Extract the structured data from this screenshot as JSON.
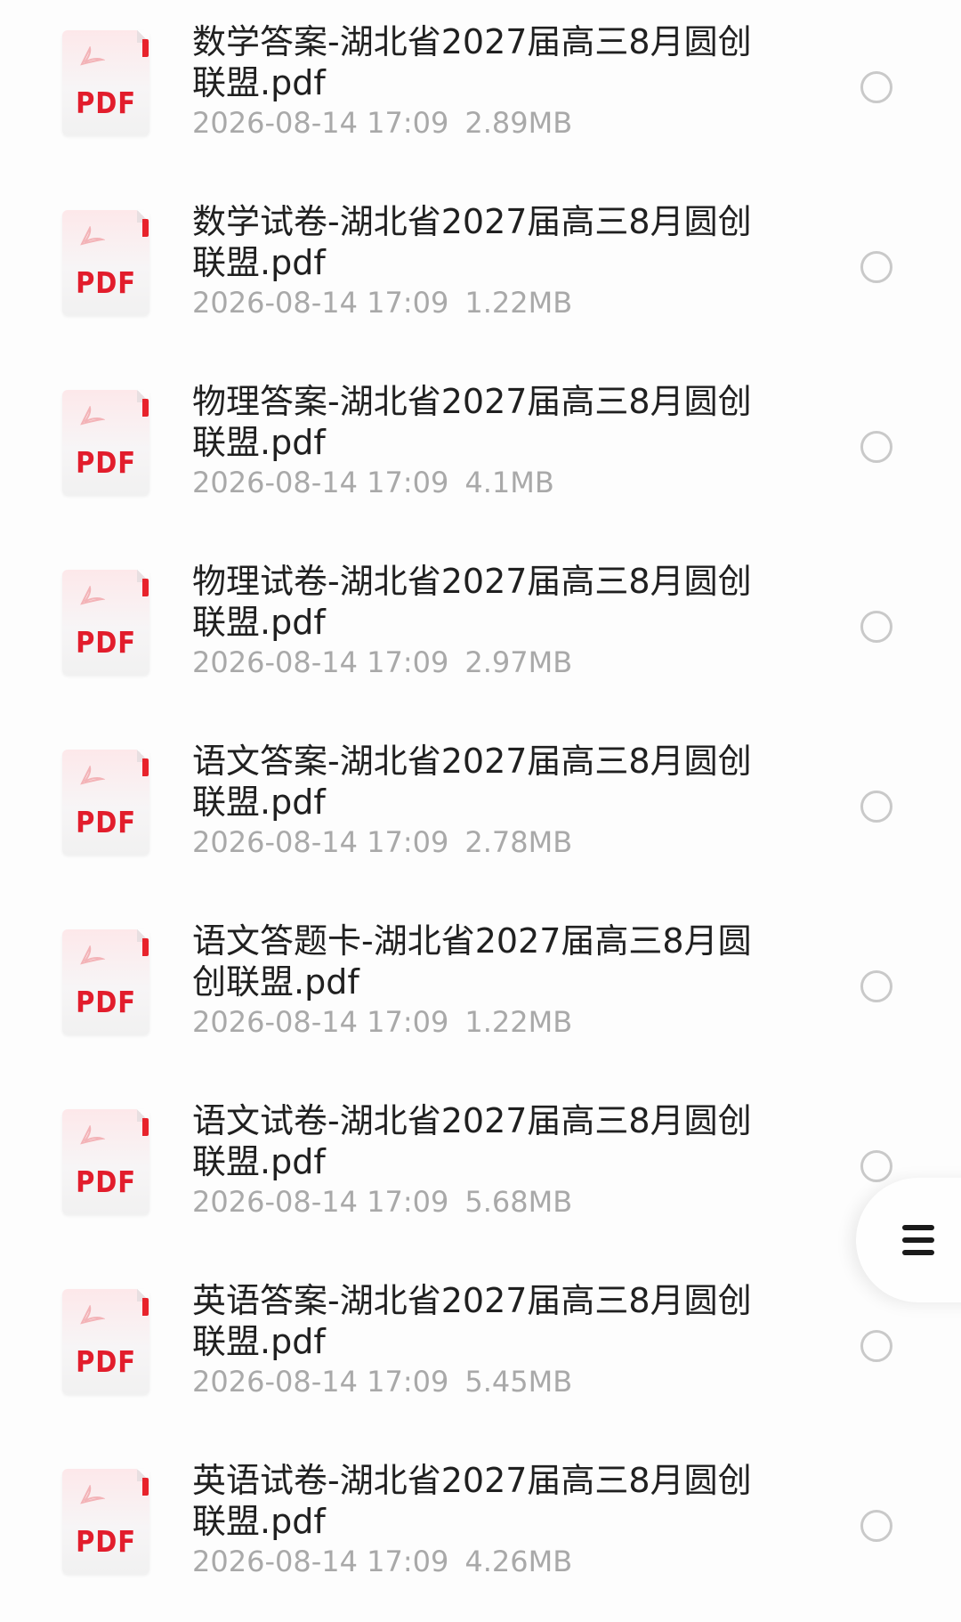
{
  "files": [
    {
      "name": "数学答案-湖北省2027届高三8月圆创联盟.pdf",
      "date": "2026-08-14 17:09",
      "size": "2.89MB",
      "icon_label": "PDF"
    },
    {
      "name": "数学试卷-湖北省2027届高三8月圆创联盟.pdf",
      "date": "2026-08-14 17:09",
      "size": "1.22MB",
      "icon_label": "PDF"
    },
    {
      "name": "物理答案-湖北省2027届高三8月圆创联盟.pdf",
      "date": "2026-08-14 17:09",
      "size": "4.1MB",
      "icon_label": "PDF"
    },
    {
      "name": "物理试卷-湖北省2027届高三8月圆创联盟.pdf",
      "date": "2026-08-14 17:09",
      "size": "2.97MB",
      "icon_label": "PDF"
    },
    {
      "name": "语文答案-湖北省2027届高三8月圆创联盟.pdf",
      "date": "2026-08-14 17:09",
      "size": "2.78MB",
      "icon_label": "PDF"
    },
    {
      "name": "语文答题卡-湖北省2027届高三8月圆创联盟.pdf",
      "date": "2026-08-14 17:09",
      "size": "1.22MB",
      "icon_label": "PDF"
    },
    {
      "name": "语文试卷-湖北省2027届高三8月圆创联盟.pdf",
      "date": "2026-08-14 17:09",
      "size": "5.68MB",
      "icon_label": "PDF"
    },
    {
      "name": "英语答案-湖北省2027届高三8月圆创联盟.pdf",
      "date": "2026-08-14 17:09",
      "size": "5.45MB",
      "icon_label": "PDF"
    },
    {
      "name": "英语试卷-湖北省2027届高三8月圆创联盟.pdf",
      "date": "2026-08-14 17:09",
      "size": "4.26MB",
      "icon_label": "PDF"
    }
  ],
  "floating_menu": {
    "icon": "hamburger-menu-icon"
  },
  "colors": {
    "pdf_red": "#e21d2c",
    "meta_gray": "#a9a9a9",
    "radio_border": "#c9c9c9",
    "background": "#fdfdfd"
  }
}
